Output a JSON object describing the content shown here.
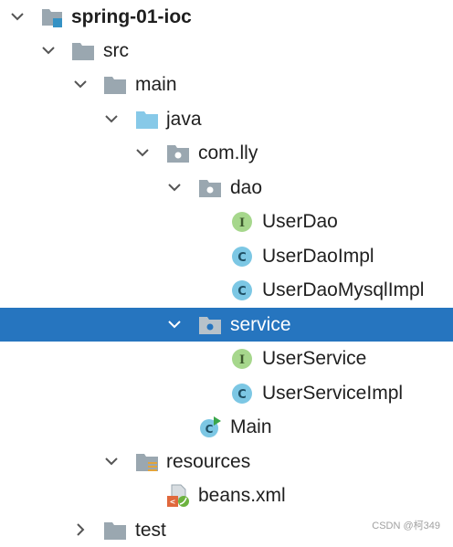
{
  "tree": {
    "nodes": [
      {
        "label": "spring-01-ioc",
        "icon": "module-folder-icon",
        "expanded": true,
        "selected": false
      },
      {
        "label": "src",
        "icon": "folder-icon",
        "expanded": true,
        "selected": false
      },
      {
        "label": "main",
        "icon": "folder-icon",
        "expanded": true,
        "selected": false
      },
      {
        "label": "java",
        "icon": "source-root-folder-icon",
        "expanded": true,
        "selected": false
      },
      {
        "label": "com.lly",
        "icon": "package-icon",
        "expanded": true,
        "selected": false
      },
      {
        "label": "dao",
        "icon": "package-icon",
        "expanded": true,
        "selected": false
      },
      {
        "label": "UserDao",
        "icon": "interface-icon",
        "selected": false
      },
      {
        "label": "UserDaoImpl",
        "icon": "class-icon",
        "selected": false
      },
      {
        "label": "UserDaoMysqlImpl",
        "icon": "class-icon",
        "selected": false
      },
      {
        "label": "service",
        "icon": "package-icon",
        "expanded": true,
        "selected": true
      },
      {
        "label": "UserService",
        "icon": "interface-icon",
        "selected": false
      },
      {
        "label": "UserServiceImpl",
        "icon": "class-icon",
        "selected": false
      },
      {
        "label": "Main",
        "icon": "runnable-class-icon",
        "selected": false
      },
      {
        "label": "resources",
        "icon": "resources-folder-icon",
        "expanded": true,
        "selected": false
      },
      {
        "label": "beans.xml",
        "icon": "spring-xml-icon",
        "selected": false
      },
      {
        "label": "test",
        "icon": "folder-icon",
        "expanded": false,
        "selected": false
      }
    ]
  },
  "colors": {
    "selection": "#2675bf",
    "folder": "#9aa7b0",
    "source_folder": "#87c9e8",
    "interface": "#a6d78c",
    "class": "#7cc7e4",
    "run": "#3aa64a"
  },
  "watermark": "CSDN @柯349"
}
